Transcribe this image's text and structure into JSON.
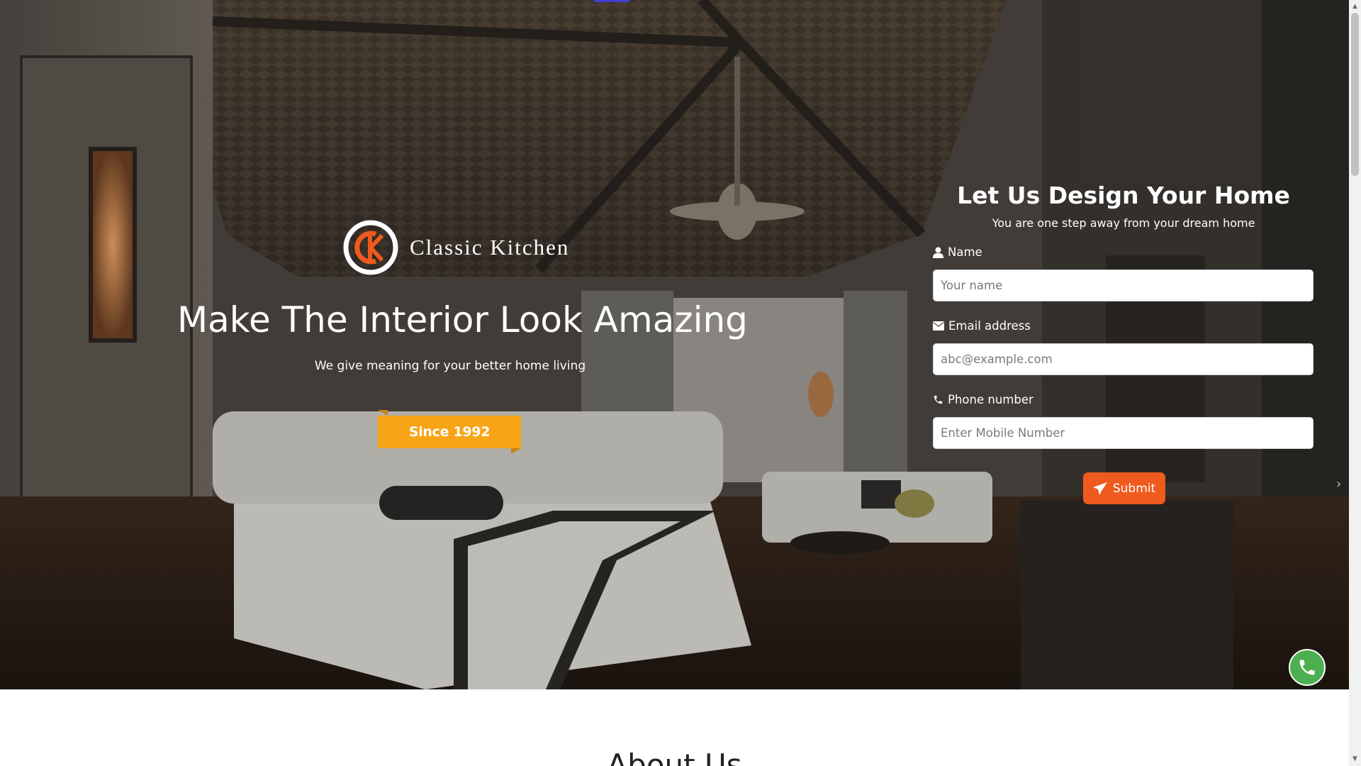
{
  "brand": {
    "name": "Classic Kitchen",
    "logo_letters": "CK"
  },
  "hero": {
    "headline": "Make The Interior Look Amazing",
    "subline": "We give meaning for your better home living",
    "ribbon_label": "Since 1992"
  },
  "form": {
    "title": "Let Us Design Your Home",
    "subtitle": "You are one step away from your dream home",
    "name_label": "Name",
    "name_placeholder": "Your name",
    "email_label": "Email address",
    "email_placeholder": "abc@example.com",
    "phone_label": "Phone number",
    "phone_placeholder": "Enter Mobile Number",
    "submit_label": "Submit"
  },
  "about": {
    "title": "About Us"
  },
  "icons": {
    "name": "user-icon",
    "email": "envelope-icon",
    "phone": "phone-icon",
    "submit": "paper-plane-icon",
    "floating": "phone-call-icon"
  },
  "colors": {
    "accent_orange": "#ef5a1e",
    "ribbon_yellow": "#f7a416",
    "call_green": "#4caf50"
  }
}
